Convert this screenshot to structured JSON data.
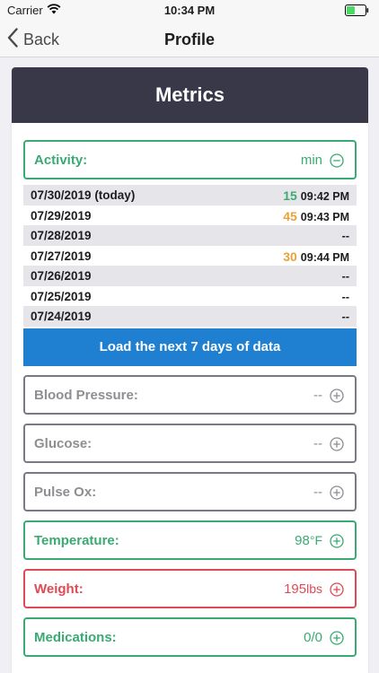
{
  "status_bar": {
    "carrier": "Carrier",
    "time": "10:34 PM"
  },
  "nav": {
    "back_label": "Back",
    "title": "Profile"
  },
  "card": {
    "header": "Metrics"
  },
  "activity": {
    "label": "Activity:",
    "value": "min",
    "rows": [
      {
        "date": "07/30/2019 (today)",
        "minutes": "15",
        "time": "09:42 PM",
        "color": "green"
      },
      {
        "date": "07/29/2019",
        "minutes": "45",
        "time": "09:43 PM",
        "color": "orange"
      },
      {
        "date": "07/28/2019",
        "minutes": "",
        "time": "--",
        "color": ""
      },
      {
        "date": "07/27/2019",
        "minutes": "30",
        "time": "09:44 PM",
        "color": "orange"
      },
      {
        "date": "07/26/2019",
        "minutes": "",
        "time": "--",
        "color": ""
      },
      {
        "date": "07/25/2019",
        "minutes": "",
        "time": "--",
        "color": ""
      },
      {
        "date": "07/24/2019",
        "minutes": "",
        "time": "--",
        "color": ""
      }
    ],
    "load_button": "Load the next 7 days of data"
  },
  "metrics": {
    "blood_pressure": {
      "label": "Blood Pressure:",
      "value": "--"
    },
    "glucose": {
      "label": "Glucose:",
      "value": "--"
    },
    "pulse_ox": {
      "label": "Pulse Ox:",
      "value": "--"
    },
    "temperature": {
      "label": "Temperature:",
      "value": "98",
      "unit": "°F"
    },
    "weight": {
      "label": "Weight:",
      "value": "195",
      "unit": "lbs"
    },
    "medications": {
      "label": "Medications:",
      "value": "0/0"
    }
  },
  "colors": {
    "green": "#3aaa72",
    "red": "#e04a55",
    "orange": "#e8a23b",
    "blue": "#1f7fd1",
    "header": "#383848"
  },
  "icons": [
    "wifi-icon",
    "battery-icon",
    "back-chevron-icon",
    "collapse-icon",
    "expand-icon"
  ]
}
